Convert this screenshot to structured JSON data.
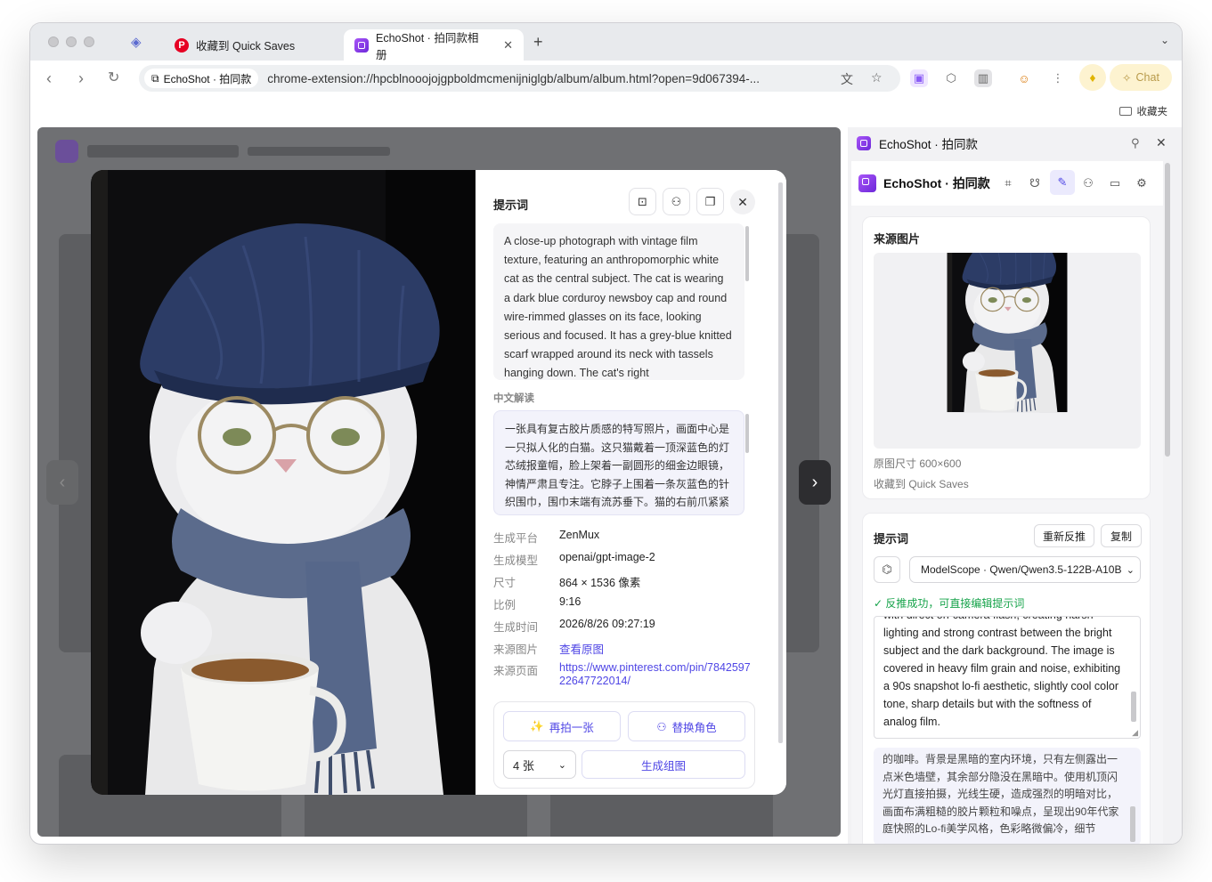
{
  "browser": {
    "tabs": [
      {
        "label": "收藏到 Quick Saves",
        "favicon": "pinterest-icon"
      },
      {
        "label": "EchoShot · 拍同款相册",
        "favicon": "echoshot-icon",
        "active": true
      }
    ],
    "new_tab": "+",
    "site_chip": "EchoShot · 拍同款",
    "url": "chrome-extension://hpcblnooojojgpboldmcmenijniglgb/album/album.html?open=9d067394-...",
    "chat_label": "Chat",
    "bookmark_folder": "收藏夹"
  },
  "modal": {
    "prompt_title": "提示词",
    "prompt_text": "A close-up photograph with vintage film texture, featuring an anthropomorphic white cat as the central subject. The cat is wearing a dark blue corduroy newsboy cap and round wire-rimmed glasses on its face, looking serious and focused. It has a grey-blue knitted scarf wrapped around its neck with tassels hanging down. The cat's right",
    "cn_title": "中文解读",
    "cn_text": "一张具有复古胶片质感的特写照片，画面中心是一只拟人化的白猫。这只猫戴着一顶深蓝色的灯芯绒报童帽，脸上架着一副圆形的细金边眼镜，神情严肃且专注。它脖子上围着一条灰蓝色的针织围巾，围巾末端有流苏垂下。猫的右前爪紧紧握着一个白色的陶瓷马克杯",
    "meta": [
      {
        "key": "生成平台",
        "value": "ZenMux"
      },
      {
        "key": "生成模型",
        "value": "openai/gpt-image-2"
      },
      {
        "key": "尺寸",
        "value": "864 × 1536 像素"
      },
      {
        "key": "比例",
        "value": "9:16"
      },
      {
        "key": "生成时间",
        "value": "2026/8/26 09:27:19"
      },
      {
        "key": "来源图片",
        "value": "查看原图",
        "link": true
      },
      {
        "key": "来源页面",
        "value": "https://www.pinterest.com/pin/784259722647722014/",
        "link": true
      }
    ],
    "retake_label": "再拍一张",
    "swap_label": "替换角色",
    "count_value": "4 张",
    "grid_label": "生成组图",
    "prev_arrow": "‹",
    "next_arrow": "›"
  },
  "panel": {
    "title": "EchoShot · 拍同款",
    "header_title": "EchoShot · 拍同款",
    "source_title": "来源图片",
    "source_size": "原图尺寸 600×600",
    "source_saved": "收藏到 Quick Saves",
    "prompt_title": "提示词",
    "regen_label": "重新反推",
    "copy_label": "复制",
    "model_select": "ModelScope · Qwen/Qwen3.5-122B-A10B",
    "success_text": "反推成功，可直接编辑提示词",
    "prompt_partial_top": "with direct on-camera flash, creating harsh",
    "prompt_text": "lighting and strong contrast between the bright subject and the dark background. The image is covered in heavy film grain and noise, exhibiting a 90s snapshot lo-fi aesthetic, slightly cool color tone, sharp details but with the softness of analog film.",
    "cn_text": "的咖啡。背景是黑暗的室内环境，只有左侧露出一点米色墙壁，其余部分隐没在黑暗中。使用机顶闪光灯直接拍摄，光线生硬，造成强烈的明暗对比，画面布满粗糙的胶片颗粒和噪点，呈现出90年代家庭快照的Lo-fi美学风格，色彩略微偏冷，细节"
  },
  "colors": {
    "accent": "#4f46e5",
    "brand": "#8b5cf6",
    "success": "#16a34a"
  }
}
